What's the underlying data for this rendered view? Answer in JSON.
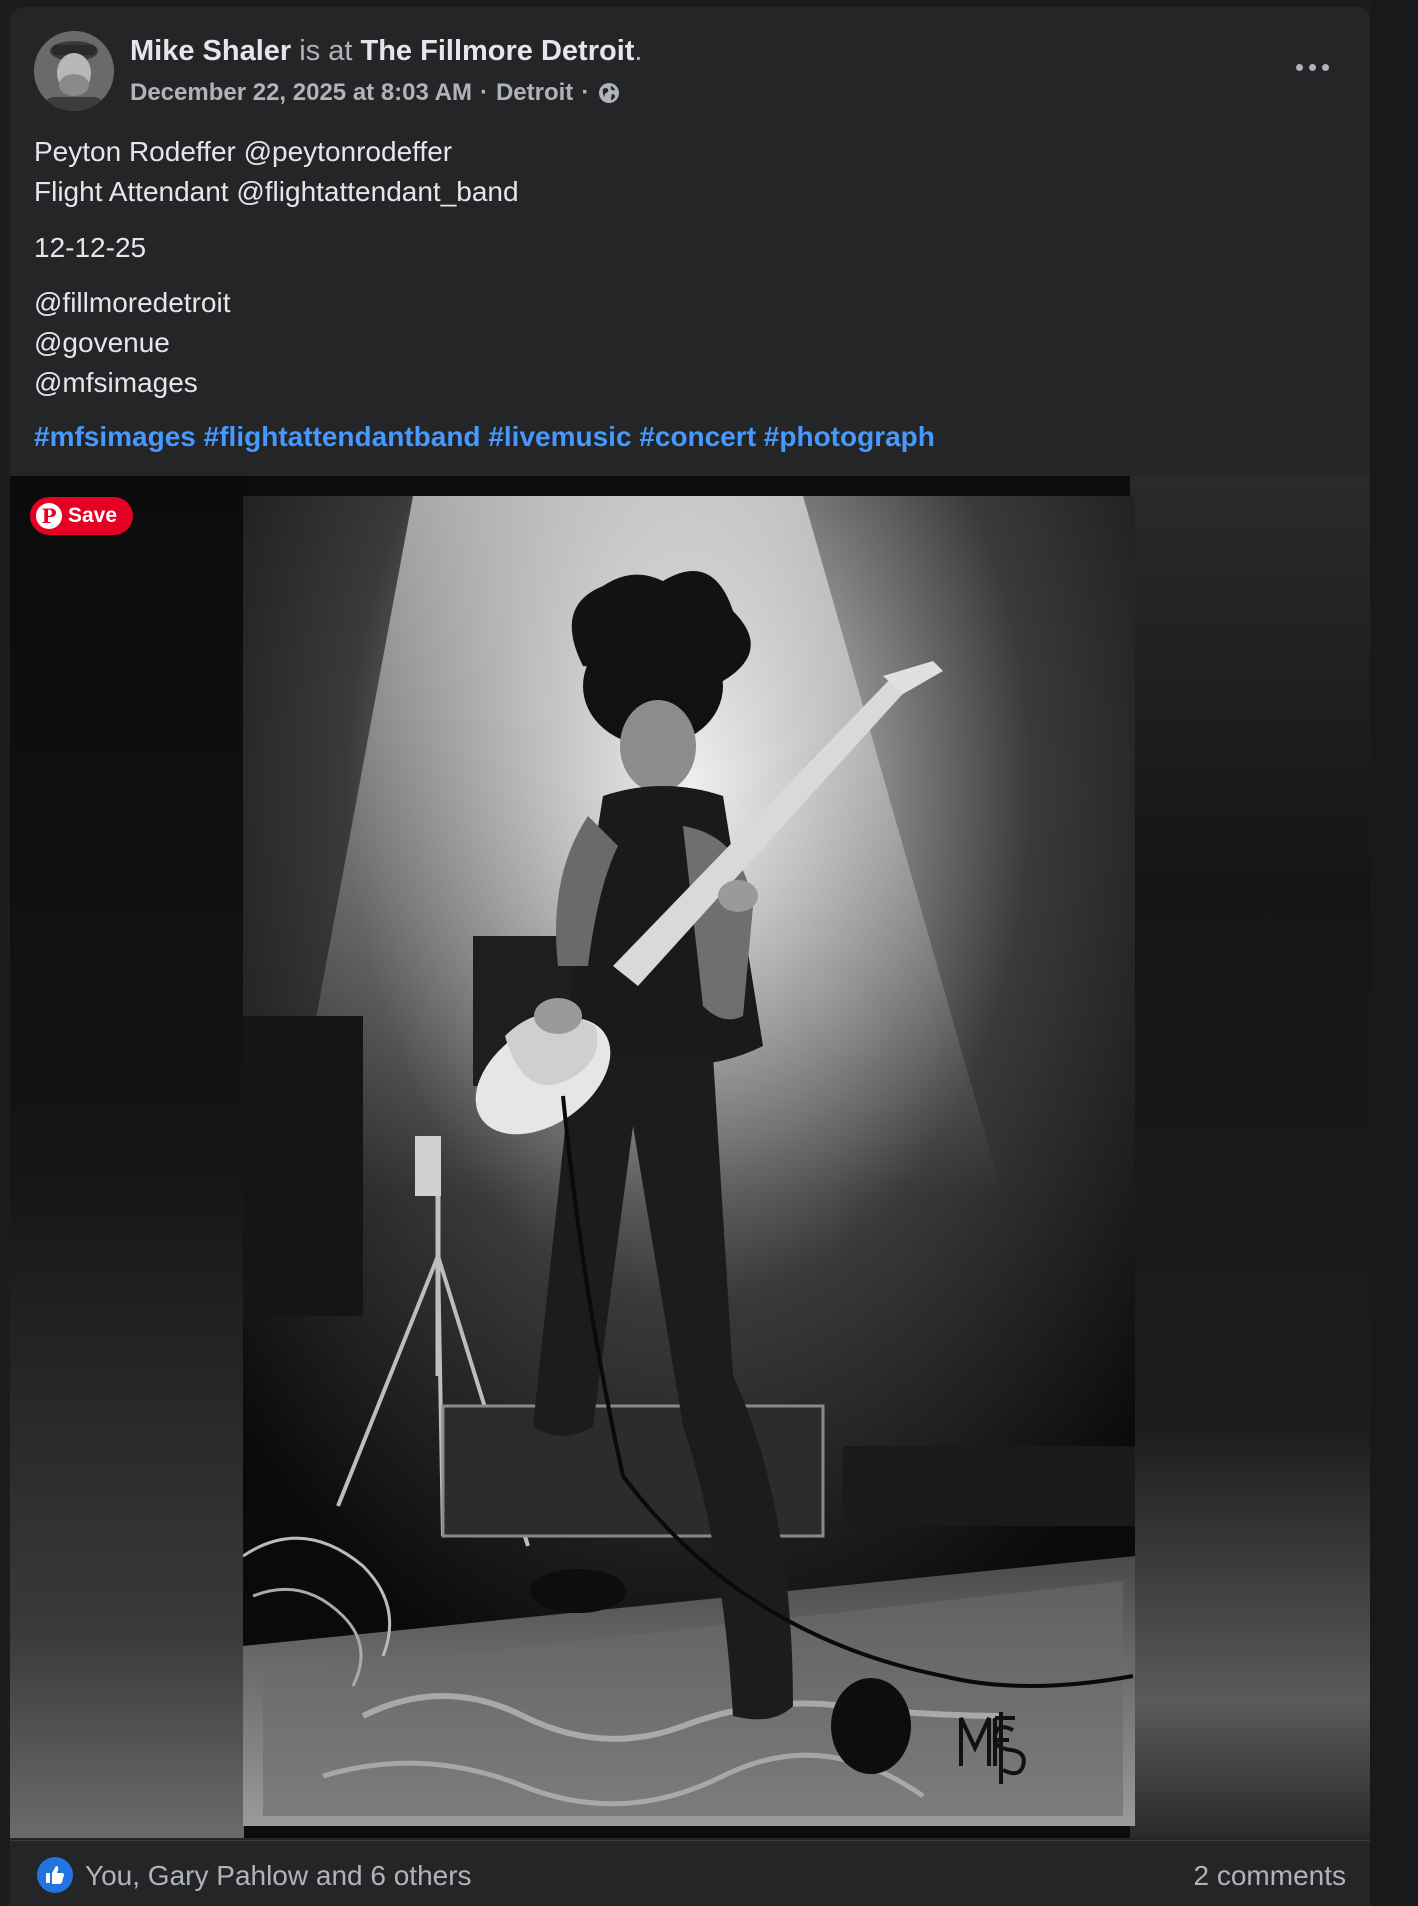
{
  "post": {
    "author": "Mike Shaler",
    "connector": "is at",
    "place": "The Fillmore Detroit",
    "place_suffix": ".",
    "date": "December 22, 2025 at 8:03 AM",
    "sep1": "·",
    "location": "Detroit",
    "sep2": "·",
    "privacy_icon": "globe-icon",
    "more_icon": "more-options-icon"
  },
  "content": {
    "lines1": [
      "Peyton Rodeffer @peytonrodeffer",
      "Flight Attendant @flightattendant_band"
    ],
    "date_line": "12-12-25",
    "mentions": [
      "@fillmoredetroit",
      "@govenue",
      "@mfsimages"
    ],
    "hashtags": [
      "#mfsimages",
      "#flightattendantband",
      "#livemusic",
      "#concert",
      "#photograph"
    ]
  },
  "photo": {
    "save_button": "Save",
    "save_icon": "pinterest-icon",
    "watermark": "MFS"
  },
  "footer": {
    "reaction_icon": "like-icon",
    "likes": "You, Gary Pahlow and 6 others",
    "comments": "2 comments"
  },
  "colors": {
    "background": "#242526",
    "text": "#e4e6eb",
    "secondary": "#b0b3b8",
    "link": "#4599ff",
    "pinterest": "#e60023",
    "like": "#2374e1"
  }
}
